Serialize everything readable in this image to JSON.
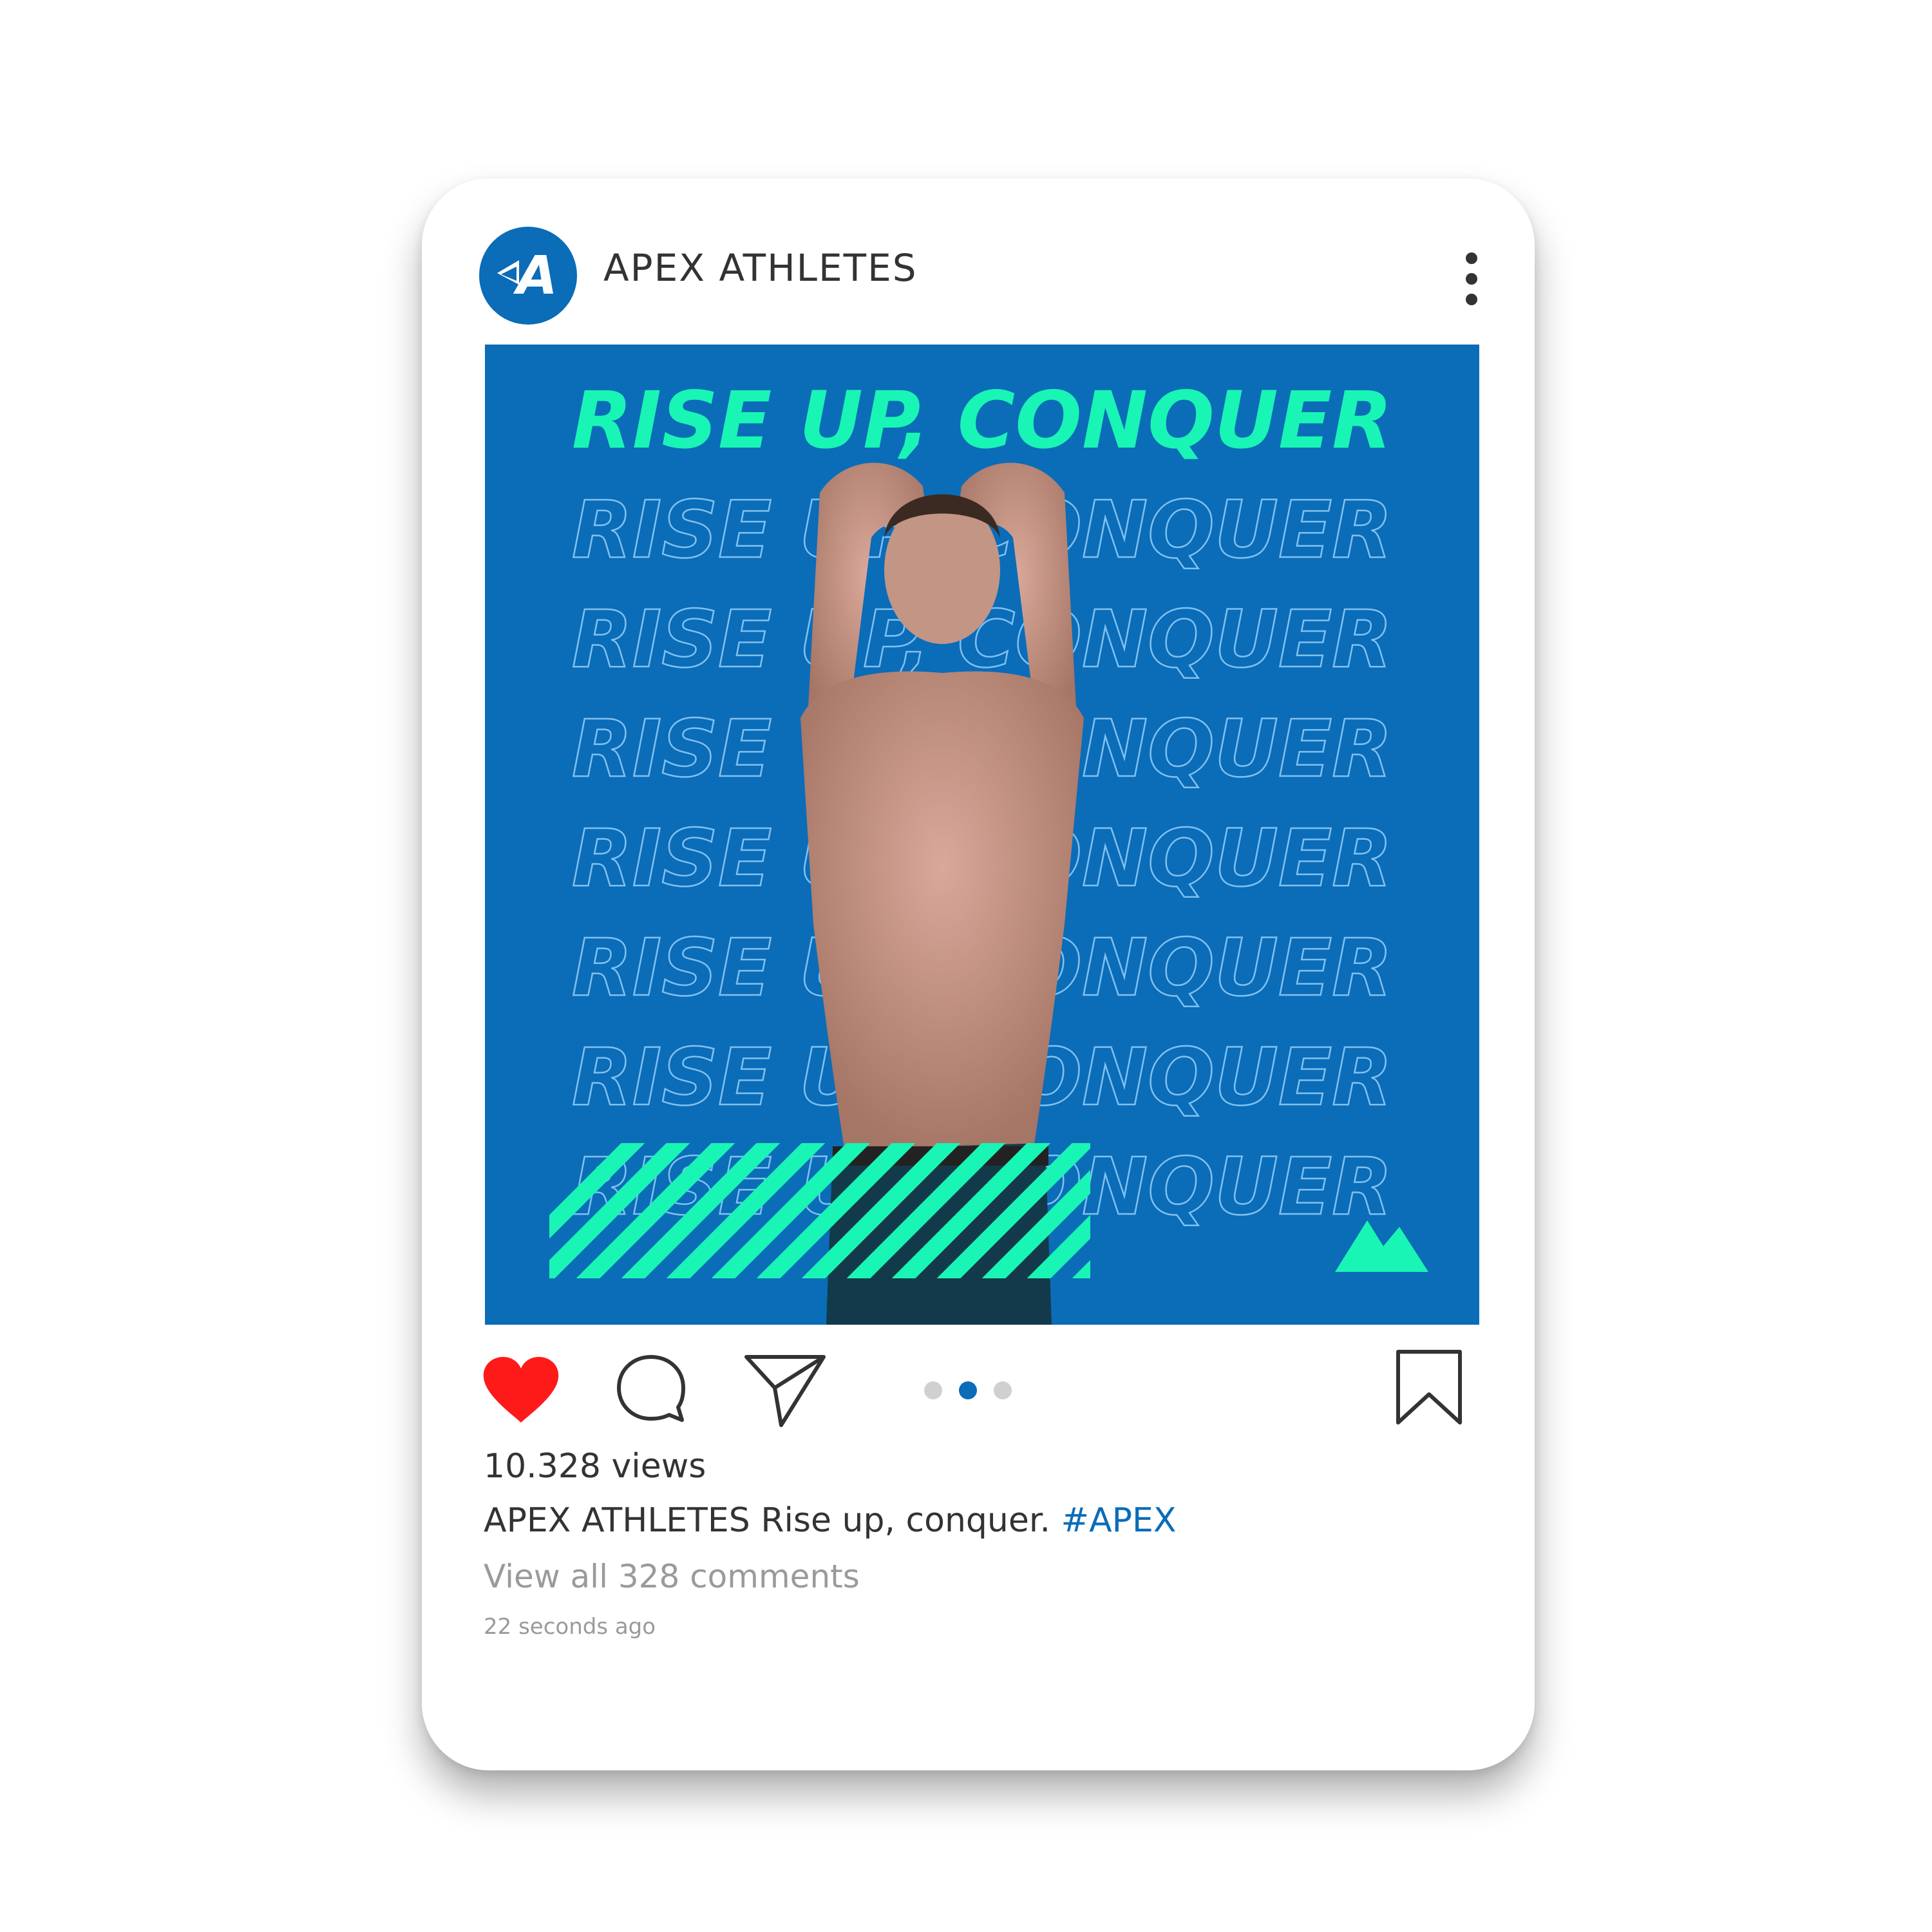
{
  "post": {
    "account_name": "APEX ATHLETES",
    "avatar_letter": "A",
    "image": {
      "headline": "RISE UP, CONQUER",
      "repeat_text": "RISE UP, CONQUER"
    },
    "views": "10.328 views",
    "caption": {
      "author": "APEX ATHLETES",
      "text": " Rise up, conquer. ",
      "hashtag": "#APEX"
    },
    "comments_link": "View all 328 comments",
    "timestamp": "22 seconds ago",
    "carousel": {
      "total": 3,
      "active": 2
    },
    "liked": true
  },
  "colors": {
    "brand_blue": "#0b6cb8",
    "accent_mint": "#19f5b4",
    "like_red": "#ff1a1a",
    "text_dark": "#333333",
    "text_muted": "#9a9a9a",
    "dot_inactive": "#d0d0d0"
  },
  "icons": {
    "avatar": "apex-logo-icon",
    "more": "more-vertical-icon",
    "like": "heart-filled-icon",
    "comment": "speech-bubble-icon",
    "share": "paper-plane-icon",
    "save": "bookmark-icon",
    "mountain": "mountain-icon"
  }
}
